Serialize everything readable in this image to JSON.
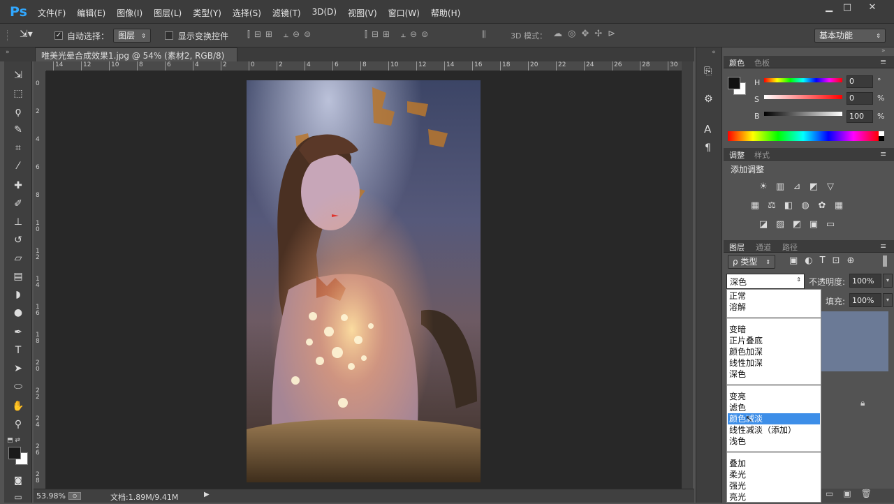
{
  "app": {
    "logo": "Ps"
  },
  "menu": [
    "文件(F)",
    "编辑(E)",
    "图像(I)",
    "图层(L)",
    "类型(Y)",
    "选择(S)",
    "滤镜(T)",
    "3D(D)",
    "视图(V)",
    "窗口(W)",
    "帮助(H)"
  ],
  "window_controls": {
    "minimize": "▁",
    "maximize": "□",
    "close": "✕"
  },
  "options": {
    "auto_select_label": "自动选择：",
    "auto_select_value": "图层",
    "show_transform_label": "显示变换控件",
    "mode_3d_label": "3D 模式：",
    "workspace": "基本功能"
  },
  "document": {
    "tab_title": "唯美光晕合成效果1.jpg @ 54% (素材2, RGB/8) *",
    "close": "✕"
  },
  "ruler_h": [
    "14",
    "12",
    "10",
    "8",
    "6",
    "4",
    "2",
    "0",
    "2",
    "4",
    "6",
    "8",
    "10",
    "12",
    "14",
    "16",
    "18",
    "20",
    "22",
    "24",
    "26",
    "28",
    "30"
  ],
  "ruler_v": [
    "0",
    "2",
    "4",
    "6",
    "8",
    "1\n0",
    "1\n2",
    "1\n4",
    "1\n6",
    "1\n8",
    "2\n0",
    "2\n2",
    "2\n4",
    "2\n6",
    "2\n8"
  ],
  "status": {
    "zoom": "53.98%",
    "doc": "文档:1.89M/9.41M"
  },
  "color_panel": {
    "tabs": [
      "颜色",
      "色板"
    ],
    "h_label": "H",
    "h_value": "0",
    "h_unit": "°",
    "s_label": "S",
    "s_value": "0",
    "s_unit": "%",
    "b_label": "B",
    "b_value": "100",
    "b_unit": "%"
  },
  "adjust_panel": {
    "tabs": [
      "调整",
      "样式"
    ],
    "title": "添加调整"
  },
  "layers_panel": {
    "tabs": [
      "图层",
      "通道",
      "路径"
    ],
    "filter_label": "ρ 类型",
    "blend_mode": "深色",
    "opacity_label": "不透明度:",
    "opacity_value": "100%",
    "fill_label": "填充:",
    "fill_value": "100%"
  },
  "blend_modes": {
    "group1": [
      "正常",
      "溶解"
    ],
    "group2": [
      "变暗",
      "正片叠底",
      "颜色加深",
      "线性加深",
      "深色"
    ],
    "group3": [
      "变亮",
      "滤色",
      "颜色减淡",
      "线性减淡（添加）",
      "浅色"
    ],
    "group4": [
      "叠加",
      "柔光",
      "强光",
      "亮光"
    ],
    "highlighted": "颜色减淡"
  },
  "colors": {
    "accent": "#31a8ff",
    "highlight": "#3d8ee8",
    "canvas_bg": "#282828"
  }
}
